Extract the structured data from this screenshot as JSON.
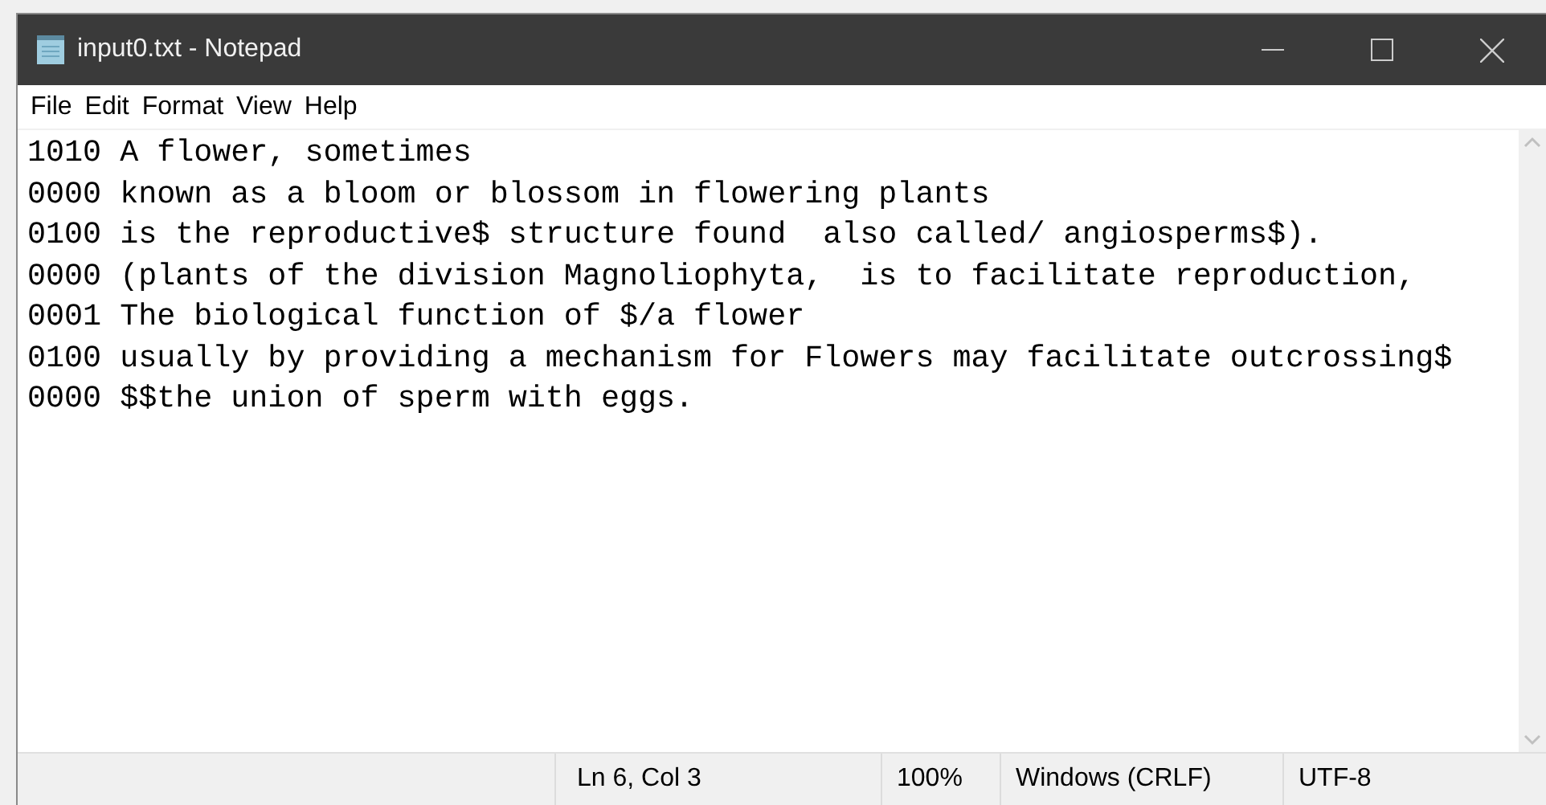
{
  "window": {
    "title": "input0.txt - Notepad"
  },
  "menu": [
    "File",
    "Edit",
    "Format",
    "View",
    "Help"
  ],
  "lines": [
    "1010 A flower, sometimes",
    "0000 known as a bloom or blossom in flowering plants",
    "0100 is the reproductive$ structure found  also called/ angiosperms$).",
    "0000 (plants of the division Magnoliophyta,  is to facilitate reproduction,",
    "0001 The biological function of $/a flower",
    "0100 usually by providing a mechanism for Flowers may facilitate outcrossing$",
    "0000 $$the union of sperm with eggs."
  ],
  "status_bar": {
    "position": "Ln 6, Col 3",
    "zoom": "100%",
    "line_endings": "Windows (CRLF)",
    "encoding": "UTF-8"
  }
}
